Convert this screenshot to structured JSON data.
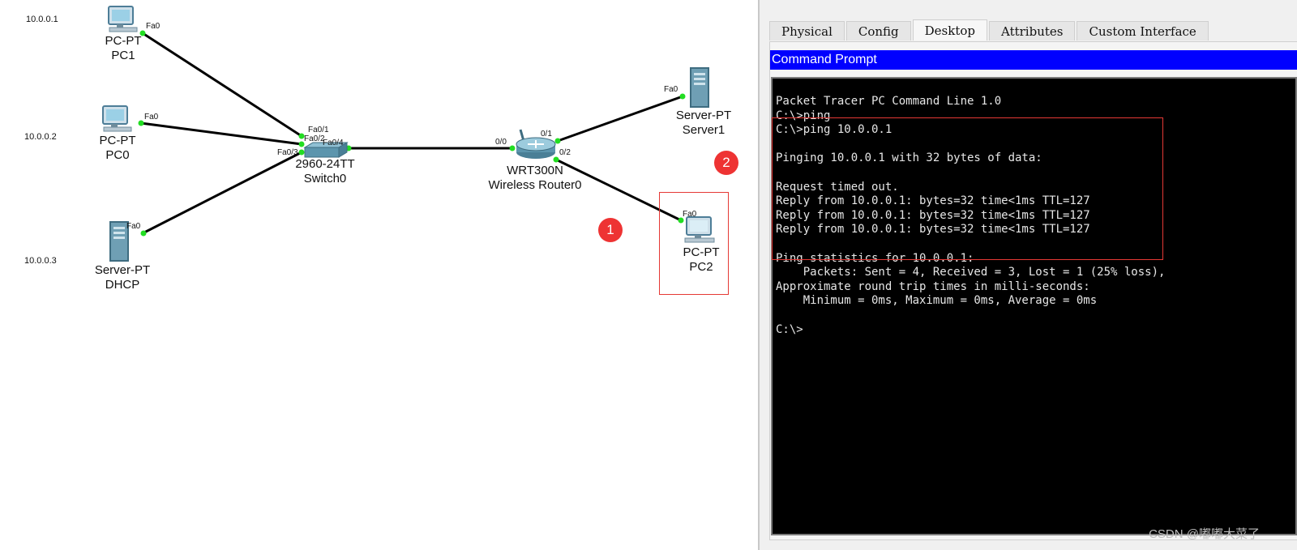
{
  "topology": {
    "devices": {
      "pc1": {
        "type_label": "PC-PT",
        "name": "PC1",
        "ip": "10.0.0.1",
        "port": "Fa0"
      },
      "pc0": {
        "type_label": "PC-PT",
        "name": "PC0",
        "ip": "10.0.0.2",
        "port": "Fa0"
      },
      "dhcp": {
        "type_label": "Server-PT",
        "name": "DHCP",
        "ip": "10.0.0.3",
        "port": "Fa0"
      },
      "switch": {
        "type_label": "2960-24TT",
        "name": "Switch0",
        "ports": {
          "fa01": "Fa0/1",
          "fa02": "Fa0/2",
          "fa03": "Fa0/3",
          "fa04": "Fa0/4"
        }
      },
      "router": {
        "type_label": "WRT300N",
        "name": "Wireless Router0",
        "ports": {
          "p00": "0/0",
          "p01": "0/1",
          "p02": "0/2"
        }
      },
      "server1": {
        "type_label": "Server-PT",
        "name": "Server1",
        "port": "Fa0"
      },
      "pc2": {
        "type_label": "PC-PT",
        "name": "PC2",
        "port": "Fa0"
      }
    },
    "link_color": "#000000",
    "port_dot_color": "#22dd22",
    "badges": {
      "one": "1",
      "two": "2"
    },
    "badge_color": "#ee3333"
  },
  "pc_window": {
    "tabs": [
      "Physical",
      "Config",
      "Desktop",
      "Attributes",
      "Custom Interface"
    ],
    "active_tab": "Desktop",
    "cmd_title": "Command Prompt",
    "terminal_lines": [
      "Packet Tracer PC Command Line 1.0",
      "C:\\>ping",
      "C:\\>ping 10.0.0.1",
      "",
      "Pinging 10.0.0.1 with 32 bytes of data:",
      "",
      "Request timed out.",
      "Reply from 10.0.0.1: bytes=32 time<1ms TTL=127",
      "Reply from 10.0.0.1: bytes=32 time<1ms TTL=127",
      "Reply from 10.0.0.1: bytes=32 time<1ms TTL=127",
      "",
      "Ping statistics for 10.0.0.1:",
      "    Packets: Sent = 4, Received = 3, Lost = 1 (25% loss),",
      "Approximate round trip times in milli-seconds:",
      "    Minimum = 0ms, Maximum = 0ms, Average = 0ms",
      "",
      "C:\\>"
    ],
    "titlebar_color": "#0000ff"
  },
  "watermark": "CSDN @嘟嘟大菜了"
}
